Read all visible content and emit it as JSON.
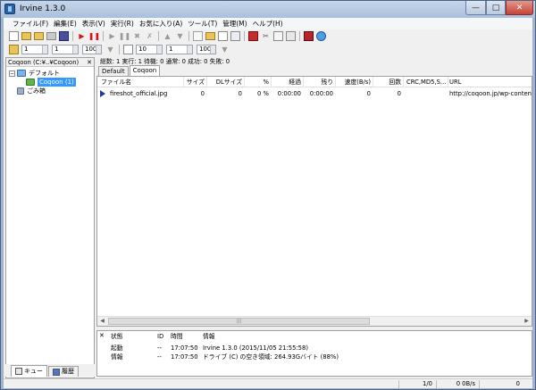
{
  "window": {
    "title": "Irvine 1.3.0",
    "min": "—",
    "max": "□",
    "close": "✕"
  },
  "menu": [
    "ファイル(F)",
    "編集(E)",
    "表示(V)",
    "実行(R)",
    "お気に入り(A)",
    "ツール(T)",
    "管理(M)",
    "ヘルプ(H)"
  ],
  "toolbar2": {
    "spin1": "1",
    "spin2": "1",
    "spin3": "100",
    "spin4": "10",
    "spin5": "1",
    "spin6": "100"
  },
  "left": {
    "header": "Coqoon (C:¥..¥Coqoon)",
    "close": "✕",
    "tree_toggle": "−",
    "tree_default": "デフォルト",
    "tree_coqoon": "Coqoon (1)",
    "tree_trash": "ごみ箱",
    "tab_queue": "キュー",
    "tab_history": "履歴"
  },
  "stats": "総数: 1  実行: 1  待機: 0  通常: 0  成功: 0  失敗: 0",
  "tabs": [
    "Default",
    "Coqoon"
  ],
  "columns": [
    "ファイル名",
    "サイズ",
    "DLサイズ",
    "%",
    "経過",
    "残り",
    "速度(B/s)",
    "回数",
    "CRC,MD5,S...",
    "URL"
  ],
  "row": {
    "file": "fireshot_official.jpg",
    "size": "0",
    "dlsize": "0",
    "pct": "0 %",
    "elapsed": "0:00:00",
    "remain": "0:00:00",
    "speed": "0",
    "count": "0",
    "crc": "",
    "url": "http://coqoon.jp/wp-content/up"
  },
  "log": {
    "close": "✕",
    "headers": [
      "状態",
      "ID",
      "時間",
      "情報"
    ],
    "rows": [
      {
        "status": "起動",
        "id": "--",
        "time": "17:07:50",
        "info": "Irvine 1.3.0 (2015/11/05 21:55:58)"
      },
      {
        "status": "情報",
        "id": "--",
        "time": "17:07:50",
        "info": "ドライブ (C) の空き領域: 264.93Gバイト (88%)"
      }
    ]
  },
  "status": {
    "pages": "1/0",
    "speed": "0 0B/s",
    "count": "0"
  },
  "scroll": {
    "left": "◀",
    "right": "▶",
    "grip": "|||"
  }
}
